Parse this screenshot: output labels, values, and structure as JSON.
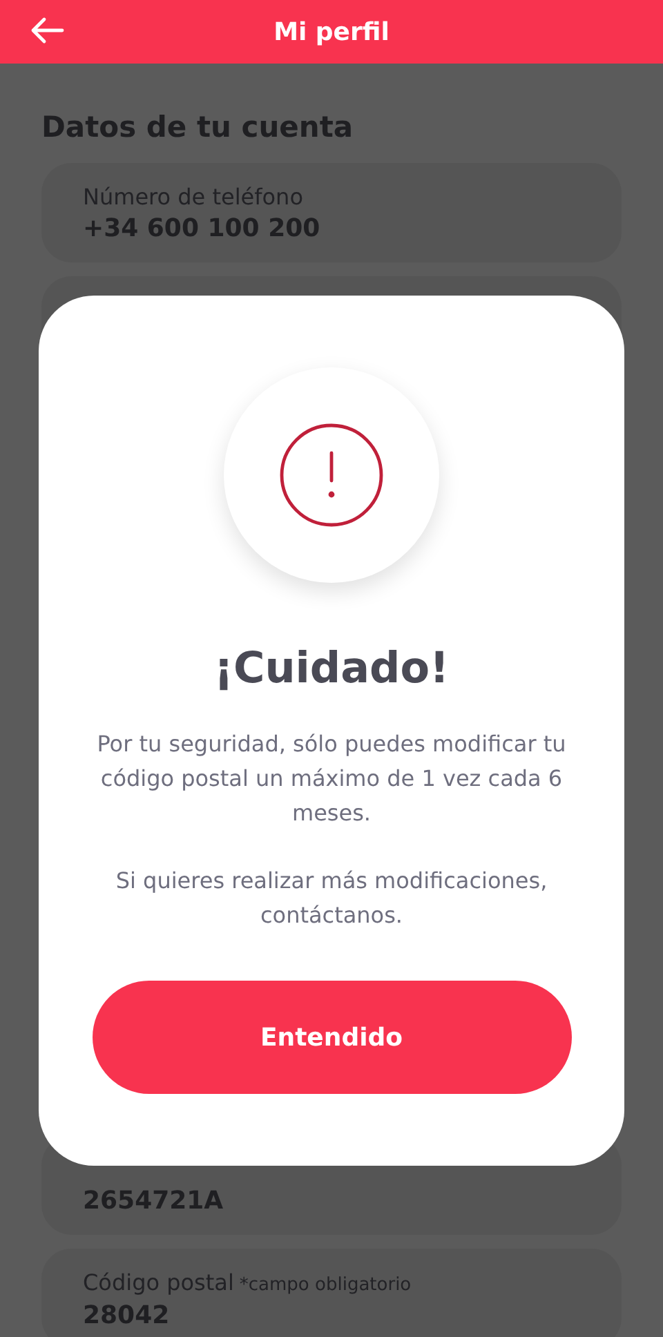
{
  "header": {
    "title": "Mi perfil"
  },
  "section_title": "Datos de tu cuenta",
  "fields": [
    {
      "label": "Número de teléfono",
      "value": "+34 600 100 200"
    },
    {
      "value": "2654721A"
    },
    {
      "label": "Código postal",
      "note": "*campo obligatorio",
      "value": "28042"
    }
  ],
  "dialog": {
    "title": "¡Cuidado!",
    "paragraphs": [
      "Por tu seguridad, sólo puedes modificar tu código postal un máximo de 1 vez cada 6 meses.",
      "Si quieres realizar más modificaciones, contáctanos."
    ],
    "button": "Entendido"
  }
}
